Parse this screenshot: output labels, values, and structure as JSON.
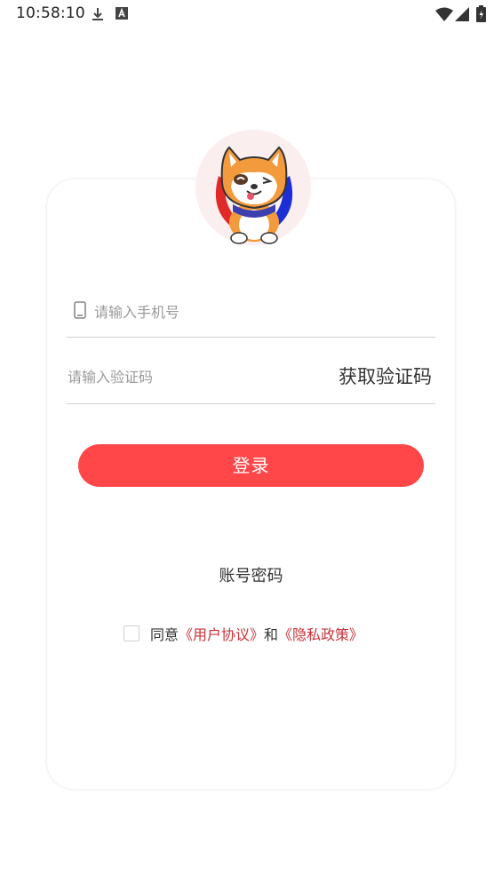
{
  "status_bar": {
    "time": "10:58:10",
    "icons": [
      "download-icon",
      "a-notification-icon",
      "wifi-icon",
      "signal-icon",
      "battery-icon"
    ]
  },
  "login": {
    "avatar_icon": "shiba-dog-mascot",
    "phone_placeholder": "请输入手机号",
    "code_placeholder": "请输入验证码",
    "get_code_label": "获取验证码",
    "login_label": "登录",
    "account_password_label": "账号密码",
    "agreement": {
      "prefix": "同意",
      "user_agreement": "《用户协议》",
      "and": "和",
      "privacy_policy": "《隐私政策》"
    }
  },
  "colors": {
    "primary": "#ff474a",
    "link": "#c8323a"
  }
}
